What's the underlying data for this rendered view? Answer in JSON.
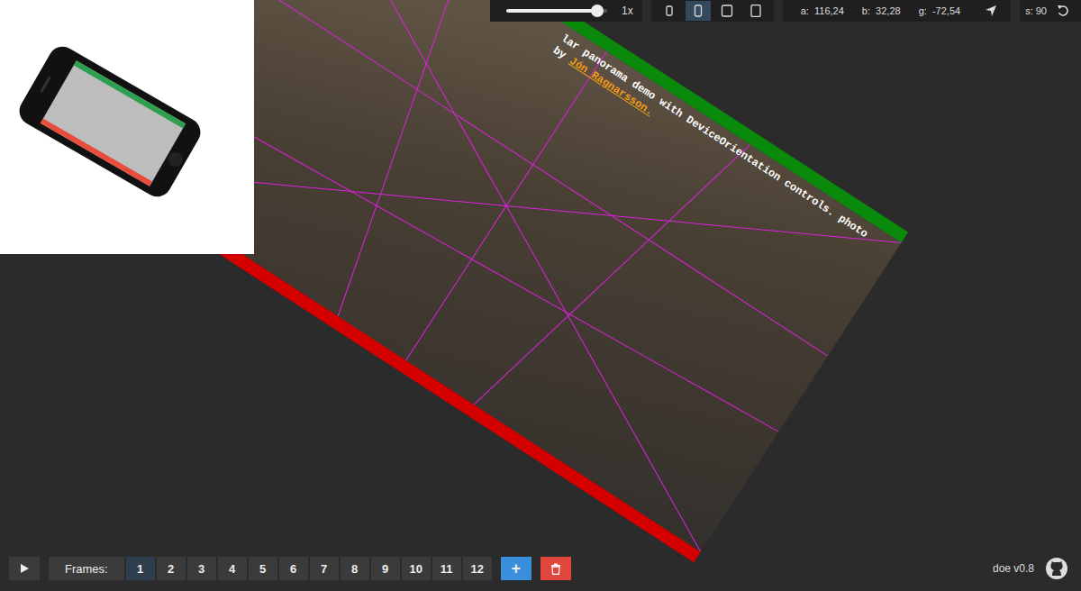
{
  "toolbar": {
    "zoom": {
      "level": 0.9,
      "label": "1x"
    },
    "devices": [
      {
        "kind": "phone-small",
        "selected": false
      },
      {
        "kind": "phone",
        "selected": true
      },
      {
        "kind": "tablet",
        "selected": false
      },
      {
        "kind": "tablet-tall",
        "selected": false
      }
    ],
    "orientation": [
      {
        "label": "a:",
        "value": "116,24"
      },
      {
        "label": "b:",
        "value": "32,28"
      },
      {
        "label": "g:",
        "value": "-72,54"
      }
    ],
    "speed": {
      "label": "s:",
      "value": "90"
    }
  },
  "preview": {
    "caption": "lar panorama demo with DeviceOrientation controls. photo by",
    "credit": "Jón Ragnarsson."
  },
  "timeline": {
    "frames_label": "Frames:",
    "frames": [
      {
        "label": "1",
        "selected": true
      },
      {
        "label": "2",
        "selected": false
      },
      {
        "label": "3",
        "selected": false
      },
      {
        "label": "4",
        "selected": false
      },
      {
        "label": "5",
        "selected": false
      },
      {
        "label": "6",
        "selected": false
      },
      {
        "label": "7",
        "selected": false
      },
      {
        "label": "8",
        "selected": false
      },
      {
        "label": "9",
        "selected": false
      },
      {
        "label": "10",
        "selected": false
      },
      {
        "label": "11",
        "selected": false
      },
      {
        "label": "12",
        "selected": false
      }
    ],
    "add": "+"
  },
  "footer": {
    "version": "doe v0.8"
  }
}
